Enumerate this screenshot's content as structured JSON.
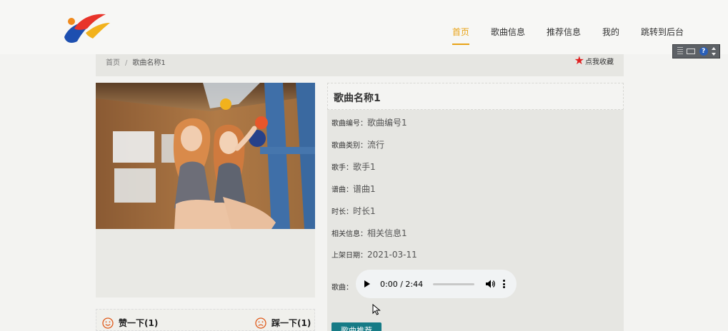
{
  "nav": {
    "items": [
      {
        "label": "首页",
        "active": true
      },
      {
        "label": "歌曲信息",
        "active": false
      },
      {
        "label": "推荐信息",
        "active": false
      },
      {
        "label": "我的",
        "active": false
      },
      {
        "label": "跳转到后台",
        "active": false
      }
    ]
  },
  "breadcrumb": {
    "home": "首页",
    "separator": "/",
    "current": "歌曲名称1"
  },
  "favorite": {
    "label": "点我收藏",
    "icon": "star-icon"
  },
  "song": {
    "title": "歌曲名称1",
    "fields": [
      {
        "label": "歌曲编号：",
        "value": "歌曲编号1"
      },
      {
        "label": "歌曲类别：",
        "value": "流行"
      },
      {
        "label": "歌手：",
        "value": "歌手1"
      },
      {
        "label": "谱曲：",
        "value": "谱曲1"
      },
      {
        "label": "时长：",
        "value": "时长1"
      },
      {
        "label": "相关信息：",
        "value": "相关信息1"
      },
      {
        "label": "上架日期：",
        "value": "2021-03-11"
      }
    ],
    "audio_label": "歌曲：",
    "audio_time": "0:00 / 2:44",
    "recommend_label": "歌曲推荐"
  },
  "votes": {
    "like": "赞一下(1)",
    "dislike": "踩一下(1)"
  },
  "colors": {
    "accent": "#e8a317",
    "favorite_star": "#e02020",
    "button": "#167b86",
    "face_icon": "#e05a1a"
  }
}
